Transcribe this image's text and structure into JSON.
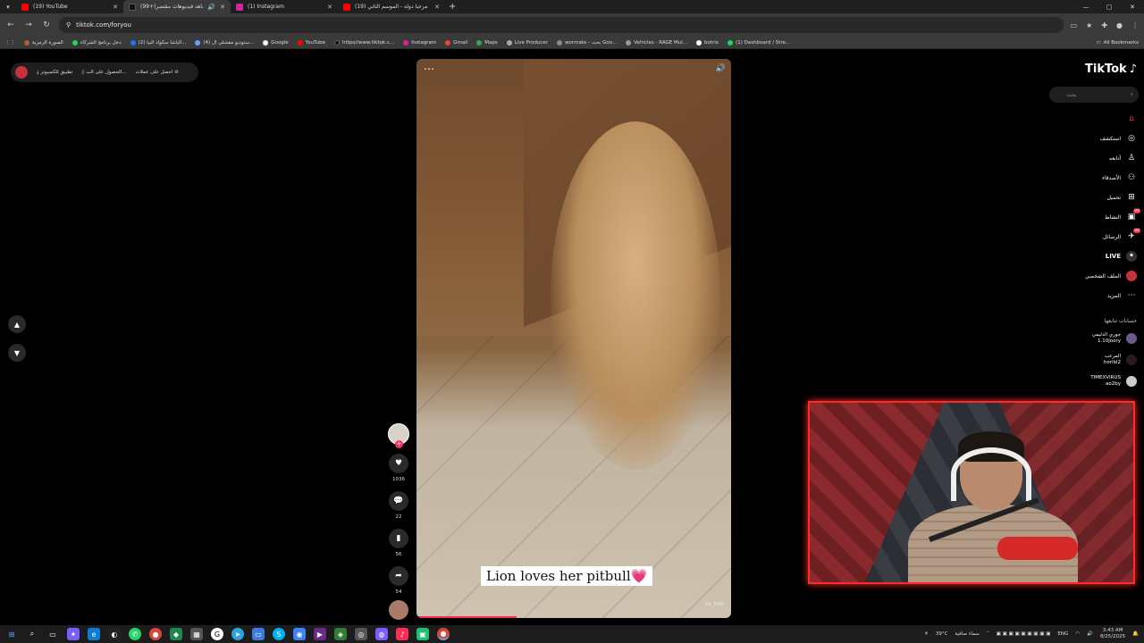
{
  "tabs": [
    {
      "title": "(19) YouTube",
      "color": "#ff0000",
      "active": false
    },
    {
      "title": "(99+)شاهد فيديوهات مقتصر",
      "color": "#111111",
      "active": true
    },
    {
      "title": "(1) Instagram",
      "color": "#d6249f",
      "active": false
    },
    {
      "title": "(19) مرحبا دولة - الموسم الثاني",
      "color": "#ff0000",
      "active": false
    }
  ],
  "address": {
    "url": "tiktok.com/foryou"
  },
  "bookmarks": [
    {
      "label": "الصورة الرمزية",
      "color": "#b55a3a"
    },
    {
      "label": "دخل برنامج الشركاء",
      "color": "#1ed760"
    },
    {
      "label": "(2) الباشا سكواد البيا...",
      "color": "#1877f2"
    },
    {
      "label": "(4) ستوديو مقشلي ال...",
      "color": "#6aa0ff"
    },
    {
      "label": "Google",
      "color": "#ffffff"
    },
    {
      "label": "YouTube",
      "color": "#ff0000"
    },
    {
      "label": "https//www.tiktok.c...",
      "color": "#111111"
    },
    {
      "label": "Instagram",
      "color": "#d6249f"
    },
    {
      "label": "Gmail",
      "color": "#ea4335"
    },
    {
      "label": "Maps",
      "color": "#34a853"
    },
    {
      "label": "Live Producer",
      "color": "#aaaaaa"
    },
    {
      "label": "wormate - بحث Goo...",
      "color": "#888888"
    },
    {
      "label": "Vehicles - RAGE Mul...",
      "color": "#999999"
    },
    {
      "label": "botrix",
      "color": "#ffffff"
    },
    {
      "label": "(1) Dashboard / Stre...",
      "color": "#1ed760"
    },
    {
      "label": "All Bookmarks",
      "color": "#cccccc"
    }
  ],
  "promo": {
    "get_coins": "احصل على عملات",
    "get_app": "الحصول على الت...",
    "pc_app": "تطبيق للكمبيوتر"
  },
  "video": {
    "caption": "Lion loves her pitbull",
    "caption_emoji": "💗",
    "watermark": "ss_be6"
  },
  "actions": {
    "likes": "1036",
    "comments": "22",
    "saves": "56",
    "shares": "54"
  },
  "sidebar": {
    "logo": "TikTok",
    "search_placeholder": "بحث",
    "items": [
      {
        "label": "",
        "icon": "home-icon"
      },
      {
        "label": "استكشف",
        "icon": "compass-icon"
      },
      {
        "label": "أتابعه",
        "icon": "following-icon"
      },
      {
        "label": "الأصدقاء",
        "icon": "friends-icon"
      },
      {
        "label": "تحميل",
        "icon": "upload-icon"
      },
      {
        "label": "النشاط",
        "icon": "activity-icon",
        "badge": "99"
      },
      {
        "label": "الرسائل",
        "icon": "messages-icon",
        "badge": "99"
      },
      {
        "label": "LIVE",
        "icon": "live-icon"
      },
      {
        "label": "الملف الشخصي",
        "icon": "profile-icon"
      },
      {
        "label": "المزيد",
        "icon": "more-icon"
      }
    ],
    "following_title": "حسابات تتابعها",
    "following": [
      {
        "name": "جوري الدليمي",
        "handle": "1.10joory"
      },
      {
        "name": "المرعب",
        "handle": "horibl2"
      },
      {
        "name": "TIMEXVIRUS",
        "handle": "ao2by"
      }
    ]
  },
  "taskbar": {
    "weather": "39°C",
    "weather_desc": "سماء صافية",
    "lang": "ENG",
    "time": "3:43 AM",
    "date": "8/25/2025"
  }
}
